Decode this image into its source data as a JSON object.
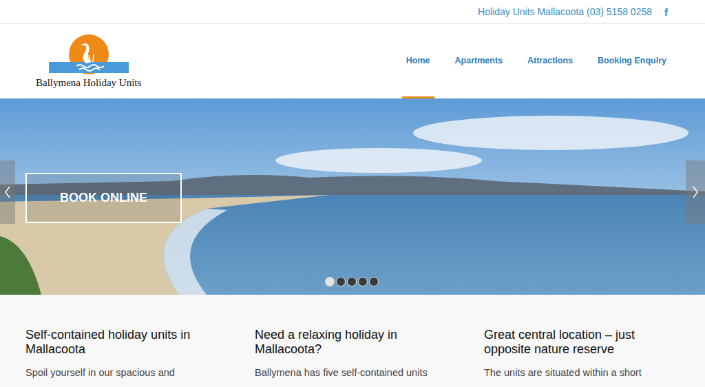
{
  "topbar": {
    "contact": "Holiday Units Mallacoota (03) 5158 0258",
    "social": "f"
  },
  "logo": {
    "name": "Ballymena Holiday Units"
  },
  "nav": [
    {
      "label": "Home",
      "selected": true
    },
    {
      "label": "Apartments",
      "selected": false
    },
    {
      "label": "Attractions",
      "selected": false
    },
    {
      "label": "Booking Enquiry",
      "selected": false
    }
  ],
  "hero": {
    "button": "BOOK ONLINE",
    "slides": [
      {
        "selected": true
      },
      {
        "selected": false
      },
      {
        "selected": false
      },
      {
        "selected": false
      },
      {
        "selected": false
      }
    ]
  },
  "features": [
    {
      "title": "Self-contained holiday units in Mallacoota",
      "text": "Spoil yourself in our spacious and"
    },
    {
      "title": "Need a relaxing holiday in Mallacoota?",
      "text": "Ballymena has five self-contained units"
    },
    {
      "title": "Great central location – just opposite nature reserve",
      "text": "The units are situated within a short"
    }
  ]
}
